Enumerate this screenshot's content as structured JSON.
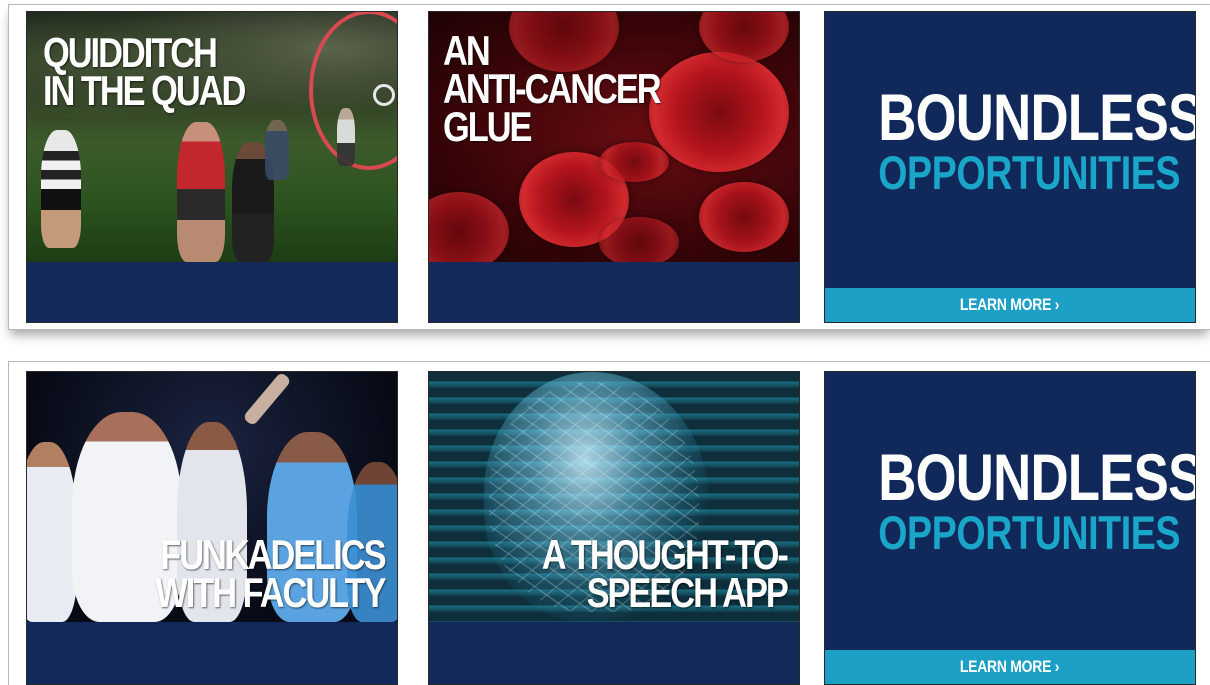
{
  "top_row": {
    "cards": [
      {
        "headline": "QUIDDITCH\nIN THE QUAD"
      },
      {
        "headline": "AN\nANTI-CANCER\nGLUE"
      },
      {
        "title": "BOUNDLESS",
        "subtitle": "OPPORTUNITIES",
        "cta": "LEARN MORE ›"
      }
    ]
  },
  "bottom_row": {
    "cards": [
      {
        "headline": "FUNKADELICS\nWITH FACULTY"
      },
      {
        "headline": "A THOUGHT-TO-\nSPEECH APP"
      },
      {
        "title": "BOUNDLESS",
        "subtitle": "OPPORTUNITIES",
        "cta": "LEARN MORE ›"
      }
    ]
  },
  "colors": {
    "navy": "#13295a",
    "accent_cyan": "#1ca0c6",
    "text_white": "#ffffff"
  }
}
